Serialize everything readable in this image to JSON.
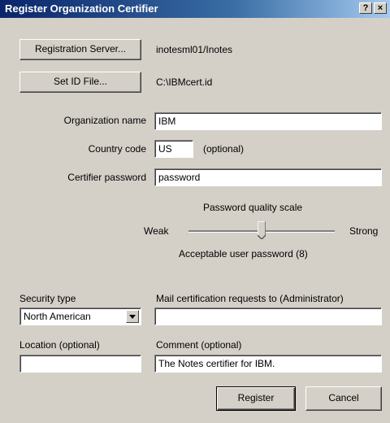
{
  "window": {
    "title": "Register Organization Certifier",
    "help_glyph": "?",
    "close_glyph": "×"
  },
  "server": {
    "button_label": "Registration Server...",
    "value": "inotesml01/Inotes"
  },
  "id_file": {
    "button_label": "Set ID File...",
    "value": "C:\\IBMcert.id"
  },
  "organization": {
    "label": "Organization name",
    "value": "IBM"
  },
  "country": {
    "label": "Country code",
    "value": "US",
    "hint": "(optional)"
  },
  "password": {
    "label": "Certifier password",
    "value": "password"
  },
  "quality": {
    "heading": "Password quality scale",
    "weak_label": "Weak",
    "strong_label": "Strong",
    "status": "Acceptable user password (8)",
    "level": 8,
    "max": 16
  },
  "security": {
    "label": "Security type",
    "selected": "North American"
  },
  "mail": {
    "label": "Mail certification requests to (Administrator)",
    "value": ""
  },
  "location": {
    "label": "Location (optional)",
    "value": ""
  },
  "comment": {
    "label": "Comment (optional)",
    "value": "The Notes certifier for IBM."
  },
  "actions": {
    "register_label": "Register",
    "cancel_label": "Cancel"
  }
}
